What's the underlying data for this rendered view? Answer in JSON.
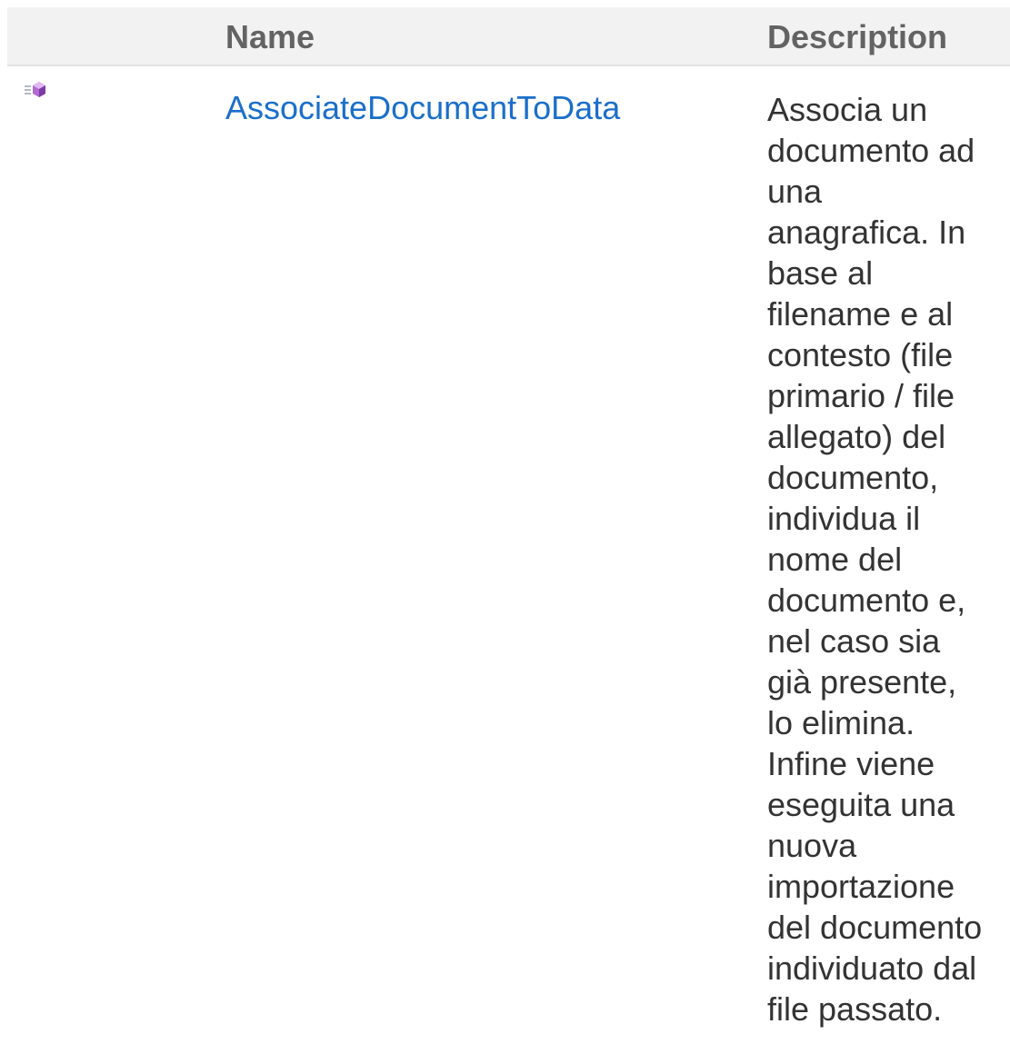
{
  "table": {
    "columns": {
      "name": "Name",
      "description": "Description"
    },
    "rows": [
      {
        "icon": "public-method-icon",
        "name": "AssociateDocumentToData",
        "description_lines": [
          "Associa un",
          "documento ad",
          "una",
          "anagrafica. In",
          "base al",
          "filename e al",
          "contesto (file",
          "primario / file",
          "allegato) del",
          "documento,",
          "individua il",
          "nome del",
          "documento e,",
          "nel caso sia",
          "già presente,",
          "lo elimina.",
          "Infine viene",
          "eseguita una",
          "nuova",
          "importazione",
          "del documento",
          "individuato dal",
          "file passato."
        ]
      }
    ]
  },
  "colors": {
    "link": "#1a6fc9",
    "header_bg": "#f2f2f2",
    "header_text": "#636363",
    "body_text": "#333333"
  }
}
